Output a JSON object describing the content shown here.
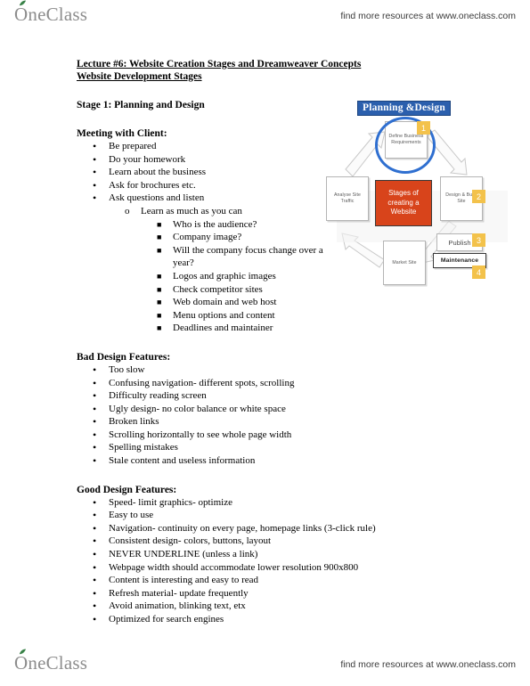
{
  "brand": {
    "logo_text_o": "O",
    "logo_text_rest": "neClass",
    "leaf_icon": "leaf-icon",
    "tagline": "find more resources at www.oneclass.com"
  },
  "document": {
    "title_line_1": "Lecture #6: Website Creation Stages and Dreamweaver Concepts",
    "title_line_2": "Website Development Stages",
    "stage_heading": "Stage 1: Planning and Design",
    "meeting_heading": "Meeting with Client:",
    "meeting_bullets": [
      "Be prepared",
      "Do your homework",
      "Learn about the business",
      "Ask for brochures etc.",
      "Ask questions and listen"
    ],
    "sub_bullet": "Learn as much as you can",
    "sub_sub_bullets": [
      "Who is the audience?",
      "Company image?",
      "Will the company focus change over a year?",
      "Logos and graphic images",
      "Check competitor sites",
      "Web domain and web host",
      "Menu options and content",
      "Deadlines and maintainer"
    ],
    "bad_heading": "Bad Design Features:",
    "bad_bullets": [
      "Too slow",
      "Confusing navigation- different spots, scrolling",
      "Difficulty reading screen",
      "Ugly design- no color balance or white space",
      "Broken links",
      "Scrolling horizontally to see whole page width",
      "Spelling mistakes",
      "Stale content and useless information"
    ],
    "good_heading": "Good Design Features:",
    "good_bullets": [
      "Speed- limit graphics- optimize",
      "Easy to use",
      "Navigation- continuity on every page, homepage links (3-click rule)",
      "Consistent design- colors, buttons, layout",
      "NEVER UNDERLINE (unless a link)",
      "Webpage width should accommodate lower resolution 900x800",
      "Content is interesting and easy to read",
      "Refresh material- update frequently",
      "Avoid animation, blinking text, etx",
      "Optimized for search engines"
    ]
  },
  "diagram": {
    "banner_label": "Planning &Design",
    "center_label": "Stages of creating a Website",
    "nodes": {
      "define": "Define Business Requirements",
      "analyse": "Analyse Site Traffic",
      "design": "Design & Build Site",
      "market": "Market Site",
      "publish": "Publish",
      "maintenance": "Maintenance"
    },
    "badges": [
      "1",
      "2",
      "3",
      "4"
    ],
    "colors": {
      "banner_bg": "#2b5fad",
      "center_bg": "#d8441b",
      "badge_bg": "#f3c24b",
      "highlight_circle": "#2f6fd0"
    }
  }
}
